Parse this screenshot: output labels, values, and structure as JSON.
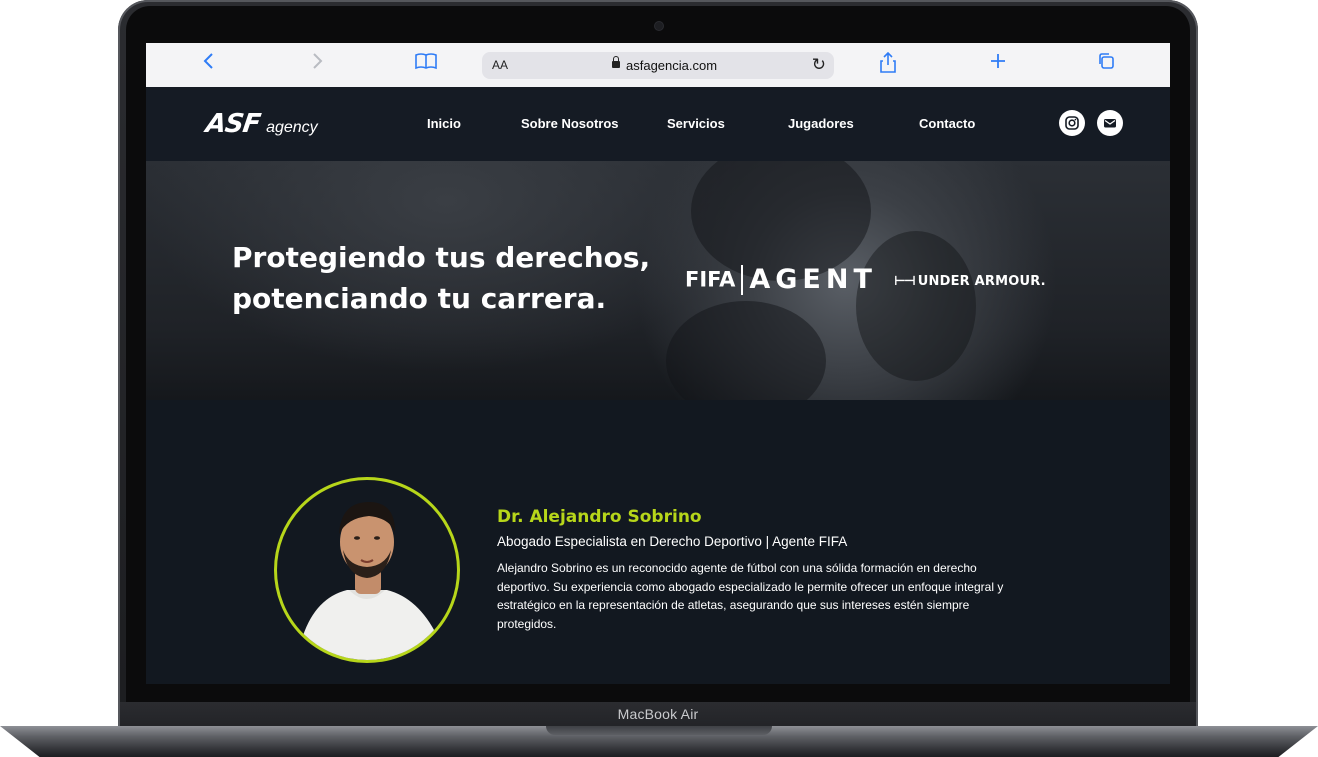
{
  "device": {
    "label": "MacBook Air"
  },
  "browser": {
    "reader_label": "AA",
    "url": "asfagencia.com",
    "icons": [
      "back-icon",
      "forward-icon",
      "bookmarks-icon",
      "reload-icon",
      "share-icon",
      "new-tab-icon",
      "tabs-icon"
    ]
  },
  "site": {
    "logo_mark": "ASF",
    "logo_word": "agency",
    "nav": [
      "Inicio",
      "Sobre Nosotros",
      "Servicios",
      "Jugadores",
      "Contacto"
    ],
    "social_icons": [
      "instagram-icon",
      "mail-icon"
    ]
  },
  "hero": {
    "title_line1": "Protegiendo tus derechos,",
    "title_line2": "potenciando tu carrera.",
    "fifa_part1": "FIFA",
    "fifa_part2": "AGENT",
    "ua_label": "UNDER ARMOUR."
  },
  "profile": {
    "name": "Dr. Alejandro Sobrino",
    "role": "Abogado Especialista en Derecho Deportivo | Agente FIFA",
    "bio": "Alejandro Sobrino es un reconocido agente de fútbol con una sólida formación en derecho deportivo. Su experiencia como abogado especializado le permite ofrecer un enfoque integral y estratégico en la representación de atletas, asegurando que sus intereses estén siempre protegidos."
  },
  "colors": {
    "accent": "#b7d61a",
    "background": "#121820",
    "nav": "#151b24",
    "safari_blue": "#2f7cf6"
  }
}
